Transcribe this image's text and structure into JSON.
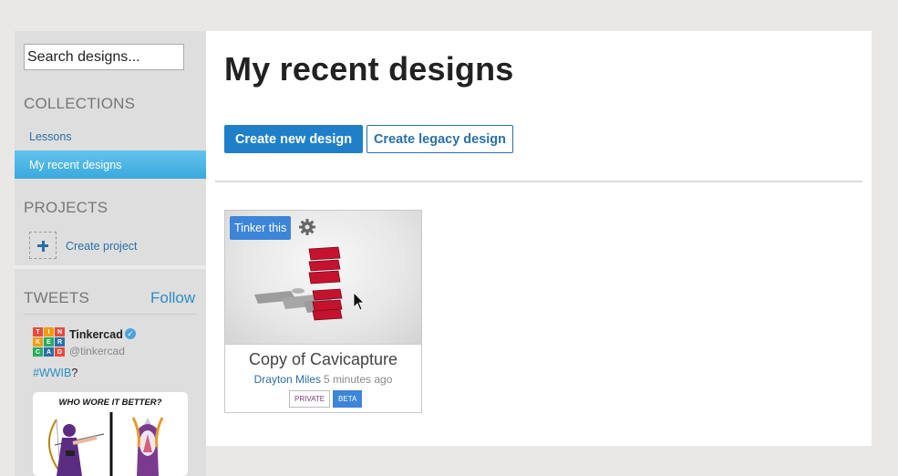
{
  "sidebar": {
    "search_placeholder": "Search designs...",
    "collections_title": "COLLECTIONS",
    "collections": [
      {
        "label": "Lessons"
      },
      {
        "label": "My recent designs"
      }
    ],
    "projects_title": "PROJECTS",
    "create_project_label": "Create project",
    "tweets": {
      "title": "TWEETS",
      "follow_label": "Follow",
      "name": "Tinkercad",
      "handle": "@tinkercad",
      "hashtag": "#WWIB",
      "text_suffix": "?",
      "logo_letters": [
        "T",
        "I",
        "N",
        "K",
        "E",
        "R",
        "C",
        "A",
        "D"
      ],
      "image_caption": "WHO WORE IT BETTER?"
    }
  },
  "main": {
    "title": "My recent designs",
    "create_new_label": "Create new design",
    "create_legacy_label": "Create legacy design",
    "designs": [
      {
        "title": "Copy of Cavicapture",
        "tinker_label": "Tinker this",
        "author": "Drayton Miles",
        "time": "5 minutes ago",
        "badges": [
          "PRIVATE",
          "BETA"
        ]
      }
    ]
  },
  "colors": {
    "primary": "#1f80c9",
    "active_nav": "#3aa9dc",
    "link": "#2a6fa8"
  }
}
